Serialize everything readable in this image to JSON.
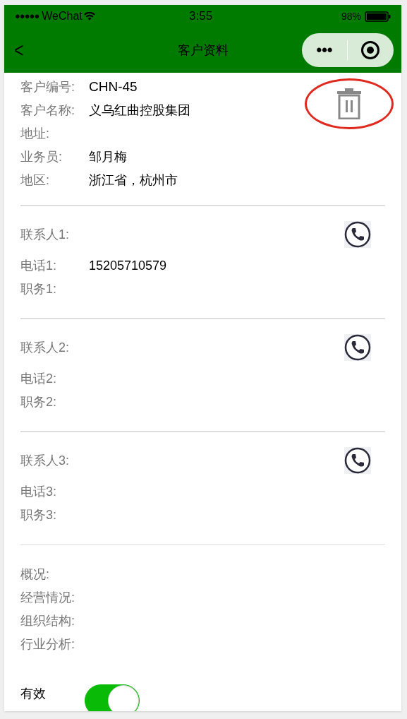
{
  "status_bar": {
    "signal": "●●●●●",
    "carrier": "WeChat",
    "time": "3:55",
    "battery": "98%"
  },
  "nav": {
    "back": "<",
    "title": "客户资料",
    "more": "•••"
  },
  "customer": [
    {
      "label": "客户编号:",
      "value": "CHN-45",
      "kind": "code"
    },
    {
      "label": "客户名称:",
      "value": "义乌红曲控股集团"
    },
    {
      "label": "地址:"
    },
    {
      "label": "业务员:",
      "value": "邹月梅"
    },
    {
      "label": "地区:",
      "value": "浙江省，杭州市"
    }
  ],
  "contacts": [
    {
      "name_label": "联系人1:",
      "phone_label": "电话1:",
      "phone": "15205710579",
      "title_label": "职务1:"
    },
    {
      "name_label": "联系人2:",
      "phone_label": "电话2:",
      "title_label": "职务2:"
    },
    {
      "name_label": "联系人3:",
      "phone_label": "电话3:",
      "title_label": "职务3:"
    }
  ],
  "overview": [
    "概况:",
    "经营情况:",
    "组织结构:",
    "行业分析:"
  ],
  "valid": {
    "label": "有效",
    "on": true
  }
}
